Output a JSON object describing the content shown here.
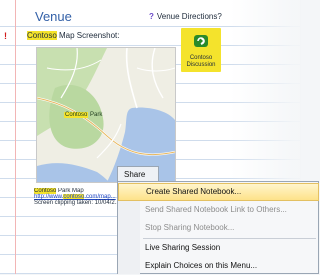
{
  "page": {
    "title": "Venue",
    "directions_label": "Venue Directions?",
    "directions_marker": "?",
    "screenshot_marker": "!",
    "screenshot_caption_highlight": "Contoso",
    "screenshot_caption_rest": " Map Screenshot:",
    "discussion_label_line1": "Contoso",
    "discussion_label_line2": "Discussion",
    "park_label_highlight": "Contoso",
    "park_label_rest": " Park"
  },
  "map_caption": {
    "line1_highlight": "Contoso",
    "line1_rest": " Park Map",
    "line2_prefix": "http://www.",
    "line2_highlight": "contoso",
    "line2_suffix": ".com/map...",
    "line3": "Screen clipping taken: 10/04/2..."
  },
  "share_menu": {
    "tab_label": "Share",
    "items": [
      {
        "label": "Create Shared Notebook...",
        "enabled": true,
        "highlighted": true
      },
      {
        "label": "Send Shared Notebook Link to Others...",
        "enabled": false
      },
      {
        "label": "Stop Sharing Notebook...",
        "enabled": false
      },
      {
        "label": "Live Sharing Session",
        "enabled": true
      },
      {
        "label": "Explain Choices on this Menu...",
        "enabled": true
      }
    ]
  },
  "colors": {
    "highlight": "#f4e32c",
    "title_blue": "#3461a8",
    "menu_hover": "#fde28a",
    "water": "#a9c4e8",
    "park": "#b9d8a0"
  },
  "icons": {
    "discussion": "discussion-icon",
    "important": "exclamation-icon",
    "question": "question-icon"
  }
}
